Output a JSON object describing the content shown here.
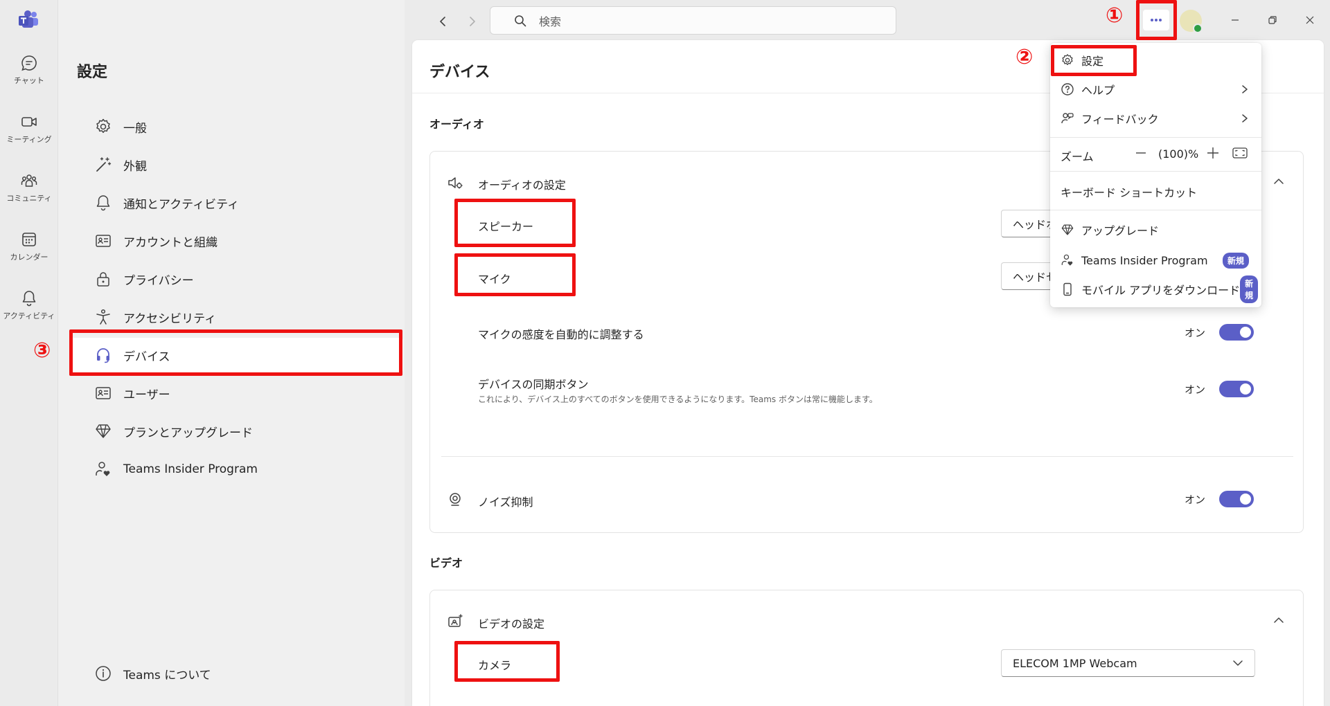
{
  "rail": {
    "items": [
      {
        "label": "チャット",
        "icon": "chat-icon"
      },
      {
        "label": "ミーティング",
        "icon": "video-icon"
      },
      {
        "label": "コミュニティ",
        "icon": "community-icon"
      },
      {
        "label": "カレンダー",
        "icon": "calendar-icon"
      },
      {
        "label": "アクティビティ",
        "icon": "bell-icon"
      }
    ]
  },
  "topbar": {
    "search_placeholder": "検索"
  },
  "nav": {
    "title": "設定",
    "items": [
      {
        "label": "一般",
        "icon": "gear-icon"
      },
      {
        "label": "外観",
        "icon": "magic-wand-icon"
      },
      {
        "label": "通知とアクティビティ",
        "icon": "bell-icon"
      },
      {
        "label": "アカウントと組織",
        "icon": "id-card-icon"
      },
      {
        "label": "プライバシー",
        "icon": "lock-icon"
      },
      {
        "label": "アクセシビリティ",
        "icon": "accessibility-icon"
      },
      {
        "label": "デバイス",
        "icon": "headset-icon",
        "active": true
      },
      {
        "label": "ユーザー",
        "icon": "contact-card-icon"
      },
      {
        "label": "プランとアップグレード",
        "icon": "diamond-icon"
      },
      {
        "label": "Teams Insider Program",
        "icon": "person-heart-icon"
      }
    ],
    "about": "Teams について"
  },
  "main": {
    "title": "デバイス",
    "audio_section": "オーディオ",
    "audio_card": {
      "title": "オーディオの設定",
      "speaker_label": "スピーカー",
      "speaker_value": "ヘッドホ",
      "mic_label": "マイク",
      "mic_value": "ヘッドセ",
      "auto_adjust_label": "マイクの感度を自動的に調整する",
      "auto_adjust_state": "オン",
      "sync_label": "デバイスの同期ボタン",
      "sync_desc": "これにより、デバイス上のすべてのボタンを使用できるようになります。Teams ボタンは常に機能します。",
      "sync_state": "オン",
      "noise_label": "ノイズ抑制",
      "noise_state": "オン"
    },
    "video_section": "ビデオ",
    "video_card": {
      "title": "ビデオの設定",
      "camera_label": "カメラ",
      "camera_value": "ELECOM 1MP Webcam"
    }
  },
  "menu": {
    "settings": "設定",
    "help": "ヘルプ",
    "feedback": "フィードバック",
    "zoom_label": "ズーム",
    "zoom_value": "(100)%",
    "shortcuts": "キーボード ショートカット",
    "upgrade": "アップグレード",
    "insider": "Teams Insider Program",
    "mobile": "モバイル アプリをダウンロード",
    "new_badge": "新規"
  },
  "annotations": {
    "num1": "①",
    "num2": "②",
    "num3": "③"
  },
  "colors": {
    "accent": "#5b5fc7",
    "annotation": "#ee1111"
  }
}
